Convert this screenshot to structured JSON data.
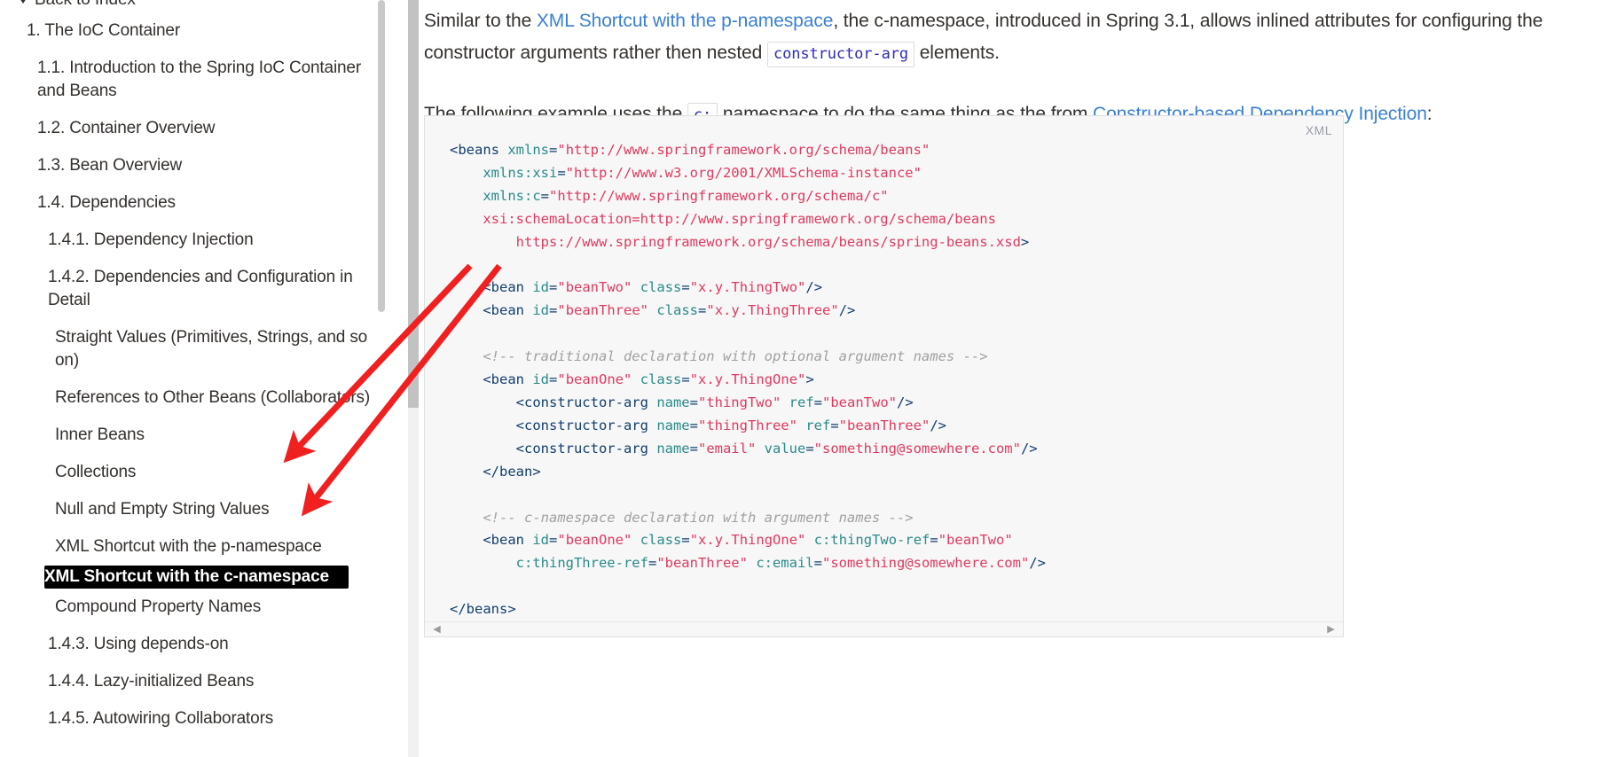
{
  "sidebar": {
    "back_label": "Back to Index",
    "back_icon": "chevron-left-icon",
    "items": [
      {
        "label": "1. The IoC Container",
        "level": 1,
        "active": false
      },
      {
        "label": "1.1. Introduction to the Spring IoC Container and Beans",
        "level": 2,
        "active": false
      },
      {
        "label": "1.2. Container Overview",
        "level": 2,
        "active": false
      },
      {
        "label": "1.3. Bean Overview",
        "level": 2,
        "active": false
      },
      {
        "label": "1.4. Dependencies",
        "level": 2,
        "active": false
      },
      {
        "label": "1.4.1. Dependency Injection",
        "level": 3,
        "active": false
      },
      {
        "label": "1.4.2. Dependencies and Configuration in Detail",
        "level": 3,
        "active": false
      },
      {
        "label": "Straight Values (Primitives, Strings, and so on)",
        "level": 4,
        "active": false
      },
      {
        "label": "References to Other Beans (Collaborators)",
        "level": 4,
        "active": false
      },
      {
        "label": "Inner Beans",
        "level": 4,
        "active": false
      },
      {
        "label": "Collections",
        "level": 4,
        "active": false
      },
      {
        "label": "Null and Empty String Values",
        "level": 4,
        "active": false
      },
      {
        "label": "XML Shortcut with the p-namespace",
        "level": 4,
        "active": false
      },
      {
        "label": "XML Shortcut with the c-namespace",
        "level": 4,
        "active": true
      },
      {
        "label": "Compound Property Names",
        "level": 4,
        "active": false
      },
      {
        "label": "1.4.3. Using depends-on",
        "level": 3,
        "active": false
      },
      {
        "label": "1.4.4. Lazy-initialized Beans",
        "level": 3,
        "active": false
      },
      {
        "label": "1.4.5. Autowiring Collaborators",
        "level": 3,
        "active": false
      }
    ]
  },
  "content": {
    "paragraph1": {
      "part1": "Similar to the ",
      "link1": "XML Shortcut with the p-namespace",
      "part2": ", the c-namespace, introduced in Spring 3.1, allows inlined attributes for configuring the constructor arguments rather then nested ",
      "code1": "constructor-arg",
      "part3": " elements."
    },
    "paragraph2": {
      "part1": "The following example uses the ",
      "code1": "c:",
      "part2": " namespace to do the same thing as the from ",
      "link1": "Constructor-based Dependency Injection",
      "part3": ":"
    }
  },
  "code_block": {
    "language_label": "XML",
    "scroll_left_icon": "caret-left-icon",
    "scroll_right_icon": "caret-right-icon",
    "lines": [
      "<beans xmlns=\"http://www.springframework.org/schema/beans\"",
      "    xmlns:xsi=\"http://www.w3.org/2001/XMLSchema-instance\"",
      "    xmlns:c=\"http://www.springframework.org/schema/c\"",
      "    xsi:schemaLocation=\"http://www.springframework.org/schema/beans",
      "        https://www.springframework.org/schema/beans/spring-beans.xsd\">",
      "",
      "    <bean id=\"beanTwo\" class=\"x.y.ThingTwo\"/>",
      "    <bean id=\"beanThree\" class=\"x.y.ThingThree\"/>",
      "",
      "    <!-- traditional declaration with optional argument names -->",
      "    <bean id=\"beanOne\" class=\"x.y.ThingOne\">",
      "        <constructor-arg name=\"thingTwo\" ref=\"beanTwo\"/>",
      "        <constructor-arg name=\"thingThree\" ref=\"beanThree\"/>",
      "        <constructor-arg name=\"email\" value=\"something@somewhere.com\"/>",
      "    </bean>",
      "",
      "    <!-- c-namespace declaration with argument names -->",
      "    <bean id=\"beanOne\" class=\"x.y.ThingOne\" c:thingTwo-ref=\"beanTwo\"",
      "        c:thingThree-ref=\"beanThree\" c:email=\"something@somewhere.com\"/>",
      "",
      "</beans>"
    ]
  },
  "annotations": {
    "arrow_color": "#f02020",
    "arrow_count": 2,
    "target": "XML Shortcut with the c-namespace"
  },
  "colors": {
    "link": "#3a7fd5",
    "active_background": "#000000",
    "active_text": "#ffffff",
    "code_tag": "#123e6e",
    "code_attr": "#2a8a8a",
    "code_string": "#e0395e",
    "code_comment": "#a0a0a0",
    "inline_code_text": "#2b2bbd"
  }
}
